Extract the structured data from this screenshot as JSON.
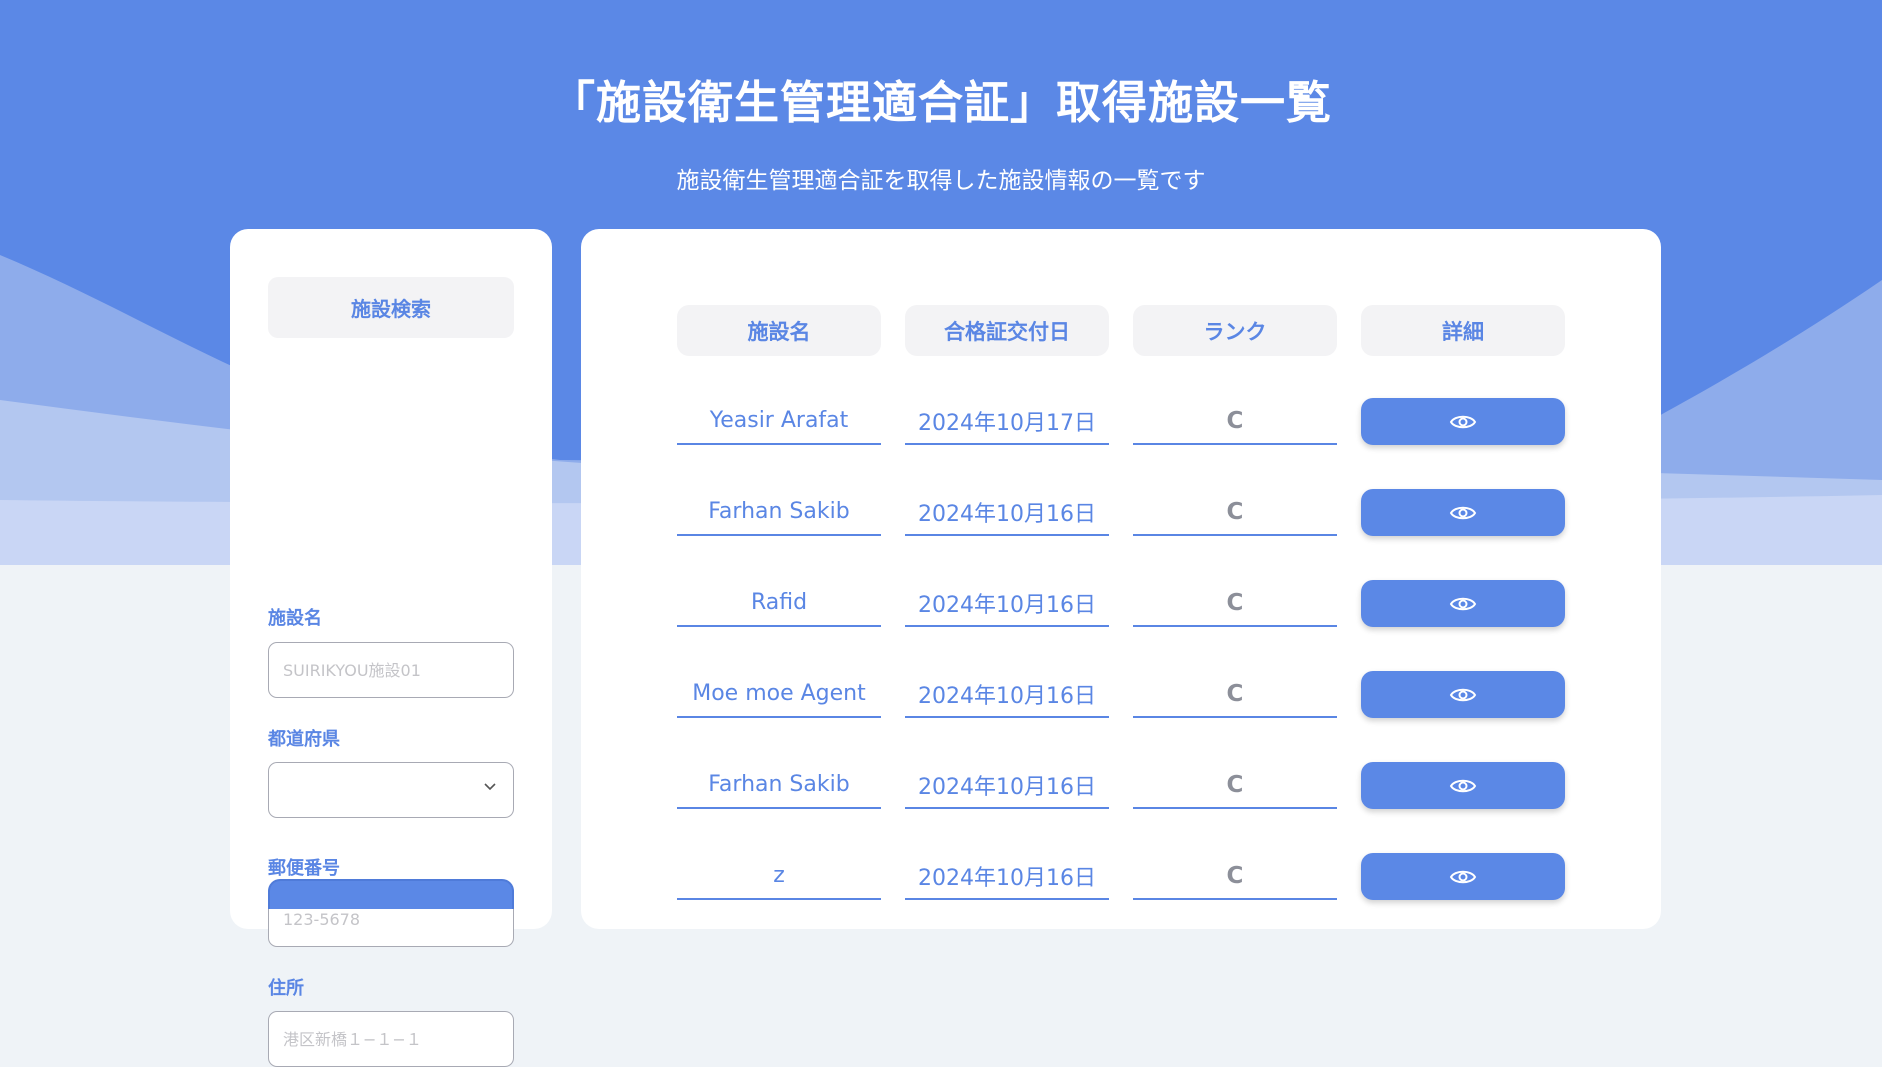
{
  "header": {
    "title": "「施設衛生管理適合証」取得施設一覧",
    "subtitle": "施設衛生管理適合証を取得した施設情報の一覧です"
  },
  "search": {
    "heading": "施設検索",
    "facility_name": {
      "label": "施設名",
      "placeholder": "SUIRIKYOU施設01",
      "value": ""
    },
    "prefecture": {
      "label": "都道府県",
      "selected": ""
    },
    "postal_code": {
      "label": "郵便番号",
      "placeholder": "123-5678",
      "value": ""
    },
    "address": {
      "label": "住所",
      "placeholder": "港区新橋１−１−１",
      "value": ""
    }
  },
  "table": {
    "headers": [
      "施設名",
      "合格証交付日",
      "ランク",
      "詳細"
    ],
    "rows": [
      {
        "name": "Yeasir Arafat",
        "date": "2024年10月17日",
        "rank": "C"
      },
      {
        "name": "Farhan Sakib",
        "date": "2024年10月16日",
        "rank": "C"
      },
      {
        "name": "Rafid",
        "date": "2024年10月16日",
        "rank": "C"
      },
      {
        "name": "Moe moe Agent",
        "date": "2024年10月16日",
        "rank": "C"
      },
      {
        "name": "Farhan Sakib",
        "date": "2024年10月16日",
        "rank": "C"
      },
      {
        "name": "z",
        "date": "2024年10月16日",
        "rank": "C"
      }
    ]
  },
  "icons": {
    "view": "eye-icon",
    "dropdown": "chevron-down-icon"
  },
  "colors": {
    "primary": "#5b88e6",
    "accent_text": "#5a86e4",
    "background": "#eff3f7",
    "rank_text": "#8c8f99"
  }
}
